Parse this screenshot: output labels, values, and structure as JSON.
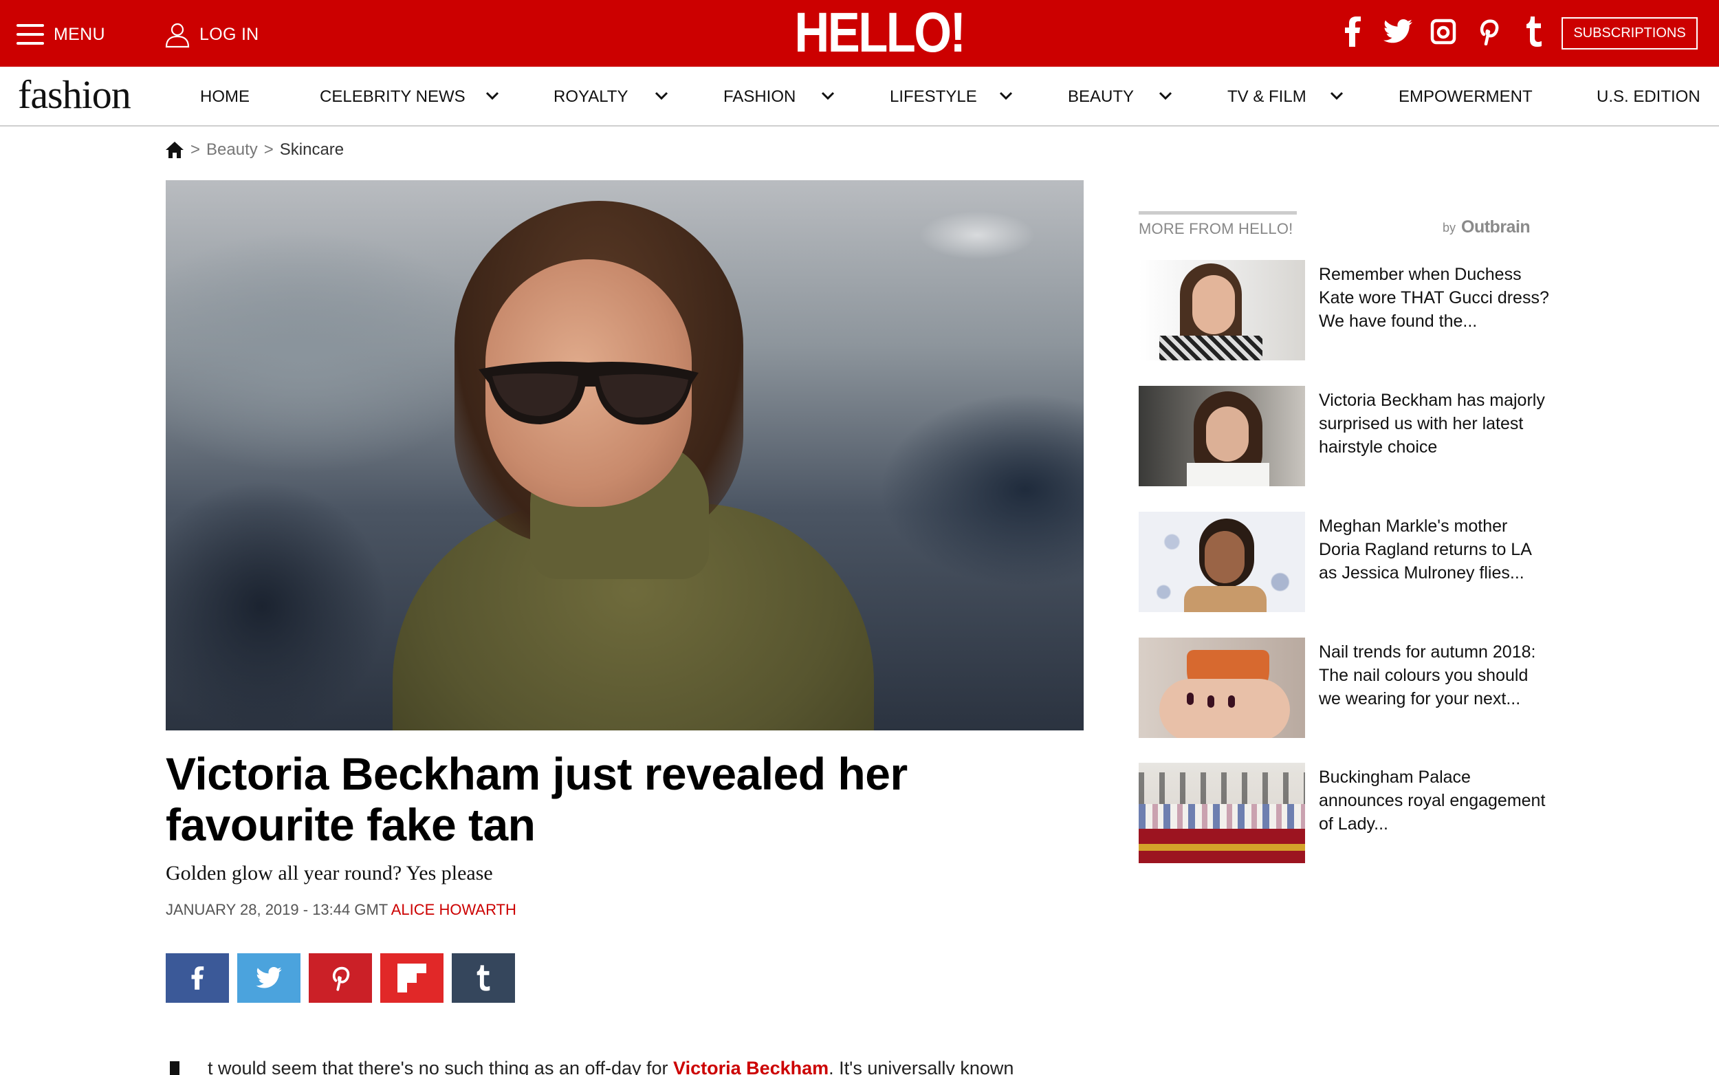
{
  "header": {
    "menu_label": "MENU",
    "login_label": "LOG IN",
    "logo_text": "HELLO!",
    "social_icons": [
      "facebook-icon",
      "twitter-icon",
      "instagram-icon",
      "pinterest-icon",
      "tumblr-icon"
    ],
    "subscriptions_label": "SUBSCRIPTIONS",
    "brand_color": "#cc0000"
  },
  "nav": {
    "brand": "fashion",
    "items": [
      {
        "label": "HOME"
      },
      {
        "label": "CELEBRITY NEWS"
      },
      {
        "label": "ROYALTY"
      },
      {
        "label": "FASHION"
      },
      {
        "label": "LIFESTYLE"
      },
      {
        "label": "BEAUTY"
      },
      {
        "label": "TV & FILM"
      },
      {
        "label": "EMPOWERMENT"
      },
      {
        "label": "U.S. EDITION"
      }
    ]
  },
  "breadcrumb": {
    "sep": ">",
    "items": [
      "Beauty",
      "Skincare"
    ]
  },
  "article": {
    "title": "Victoria Beckham just revealed her favourite fake tan",
    "standfirst": "Golden glow all year round? Yes please",
    "date": "JANUARY 28, 2019 - 13:44 GMT",
    "author": "ALICE HOWARTH",
    "share_icons": [
      "facebook-icon",
      "twitter-icon",
      "pinterest-icon",
      "flipboard-icon",
      "tumblr-icon"
    ],
    "share_colors": [
      "#3b5998",
      "#4ba3dd",
      "#cb2027",
      "#e12828",
      "#35465c"
    ],
    "body_start": "t would seem that there's no such thing as an off-day for ",
    "body_link": "Victoria Beckham",
    "body_end": ". It's universally known"
  },
  "sidebar": {
    "title": "MORE FROM HELLO!",
    "by": "by",
    "provider": "Outbrain",
    "items": [
      {
        "text": "Remember when Duchess Kate wore THAT Gucci dress? We have found the..."
      },
      {
        "text": "Victoria Beckham has majorly surprised us with her latest hairstyle choice"
      },
      {
        "text": "Meghan Markle's mother Doria Ragland returns to LA as Jessica Mulroney flies..."
      },
      {
        "text": "Nail trends for autumn 2018: The nail colours you should we wearing for your next..."
      },
      {
        "text": "Buckingham Palace announces royal engagement of Lady..."
      }
    ]
  }
}
